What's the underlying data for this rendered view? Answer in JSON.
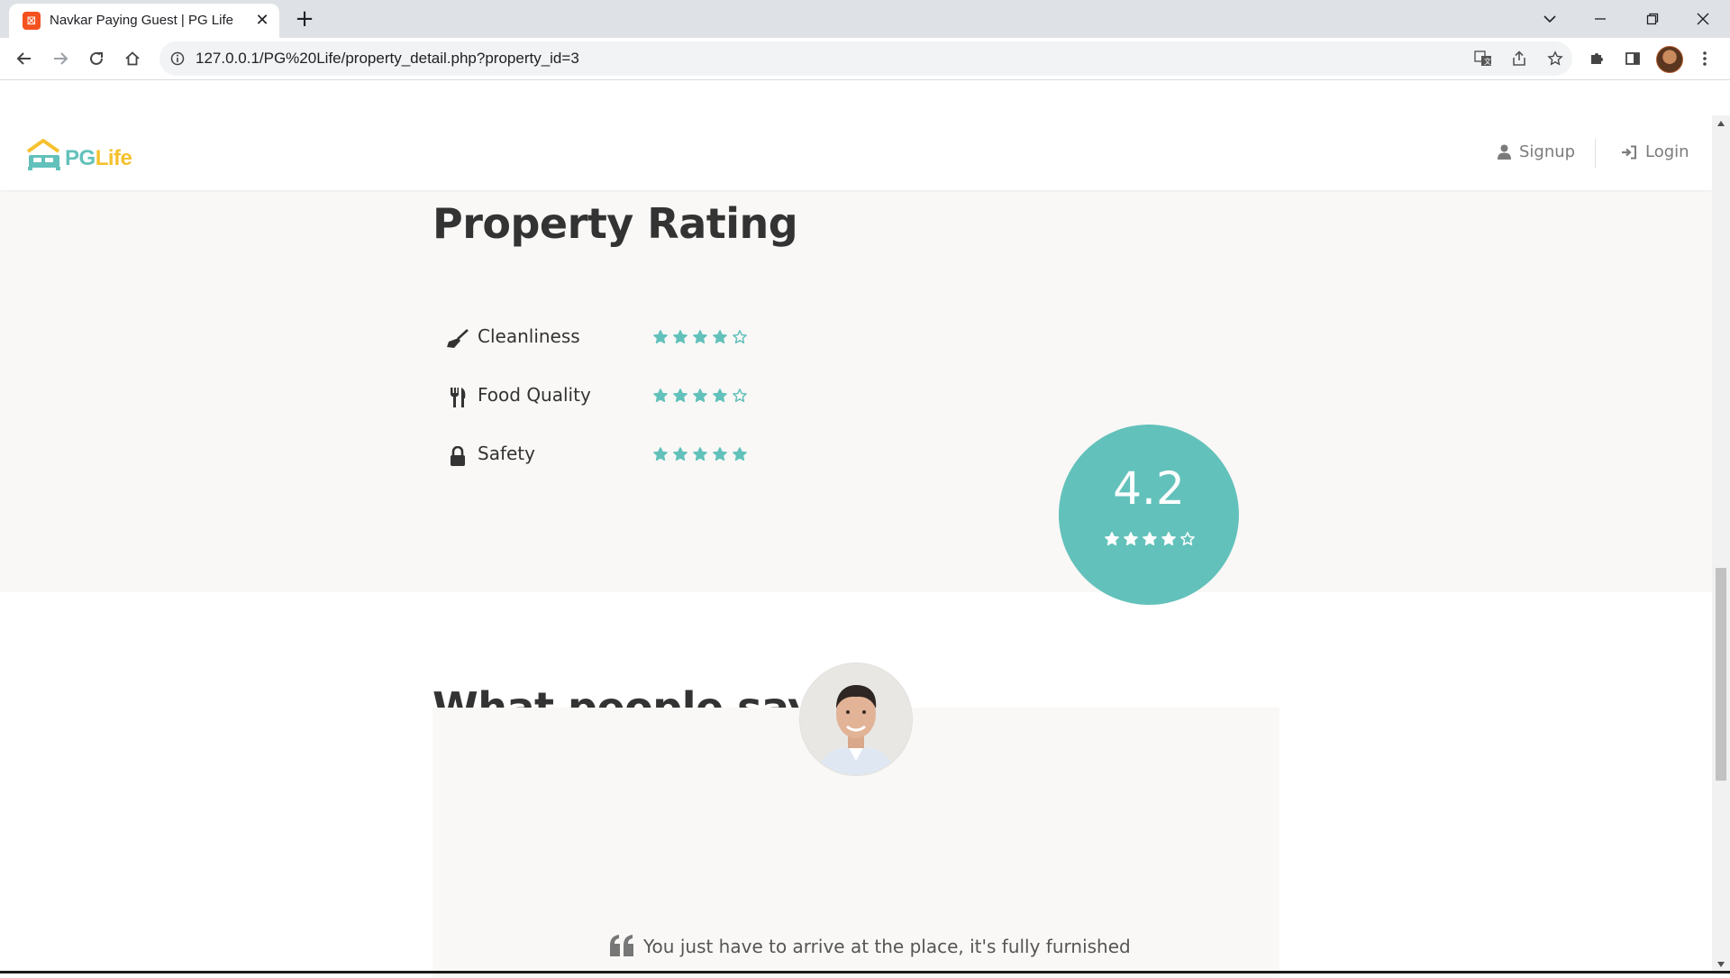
{
  "browser": {
    "tab_title": "Navkar Paying Guest | PG Life",
    "url": "127.0.0.1/PG%20Life/property_detail.php?property_id=3"
  },
  "navbar": {
    "logo_pg": "PG",
    "logo_life": "Life",
    "signup_label": "Signup",
    "login_label": "Login"
  },
  "rating_section": {
    "title": "Property Rating",
    "ratings": [
      {
        "label": "Cleanliness",
        "icon": "broom-icon",
        "stars": 4
      },
      {
        "label": "Food Quality",
        "icon": "utensils-icon",
        "stars": 4
      },
      {
        "label": "Safety",
        "icon": "lock-icon",
        "stars": 5
      }
    ],
    "overall_value": "4.2",
    "overall_stars": 4
  },
  "reviews_section": {
    "title": "What people say",
    "review_text": "You just have to arrive at the place, it's fully furnished"
  },
  "colors": {
    "accent": "#63c1bb",
    "logo_yellow": "#f6c12f",
    "section_bg": "#f9f8f6"
  }
}
